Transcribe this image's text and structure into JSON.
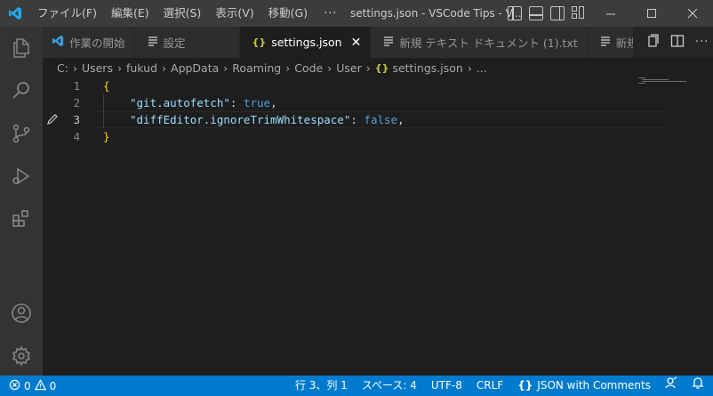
{
  "menu": [
    "ファイル(F)",
    "編集(E)",
    "選択(S)",
    "表示(V)",
    "移動(G)"
  ],
  "menu_more": "···",
  "window_title": "settings.json - VSCode Tips - V...",
  "tabs": [
    {
      "label": "作業の開始",
      "icon": "vscode-logo-icon"
    },
    {
      "label": "設定",
      "icon": "settings-list-icon"
    },
    {
      "label": "settings.json",
      "icon": "json-braces-icon",
      "icon_glyph": "{}",
      "close": "✕"
    },
    {
      "label": "新規 テキスト ドキュメント (1).txt",
      "icon": "text-file-icon"
    },
    {
      "label": "新規 テ",
      "icon": "text-file-icon"
    }
  ],
  "breadcrumb": [
    "C:",
    "Users",
    "fukud",
    "AppData",
    "Roaming",
    "Code",
    "User",
    "settings.json",
    "..."
  ],
  "breadcrumb_json_glyph": "{}",
  "editor": {
    "line_numbers": [
      "1",
      "2",
      "3",
      "4"
    ],
    "lines": {
      "l1_open": "{",
      "l2_key": "\"git.autofetch\"",
      "l2_colon": ": ",
      "l2_value": "true",
      "l2_comma": ",",
      "l3_key": "\"diffEditor.ignoreTrimWhitespace\"",
      "l3_colon": ": ",
      "l3_value": "false",
      "l3_comma": ",",
      "l4_close": "}"
    }
  },
  "statusbar": {
    "errors": "0",
    "warnings": "0",
    "position": "行 3、列 1",
    "spaces": "スペース: 4",
    "encoding": "UTF-8",
    "eol": "CRLF",
    "language_glyph": "{}",
    "language": "JSON with Comments"
  },
  "colors": {
    "accent": "#007acc",
    "titlebar": "#3c3c3c",
    "activitybar": "#333333",
    "editor_bg": "#1e1e1e",
    "json_key": "#9cdcfe",
    "json_bool": "#569cd6",
    "bracket": "#ffd700"
  }
}
